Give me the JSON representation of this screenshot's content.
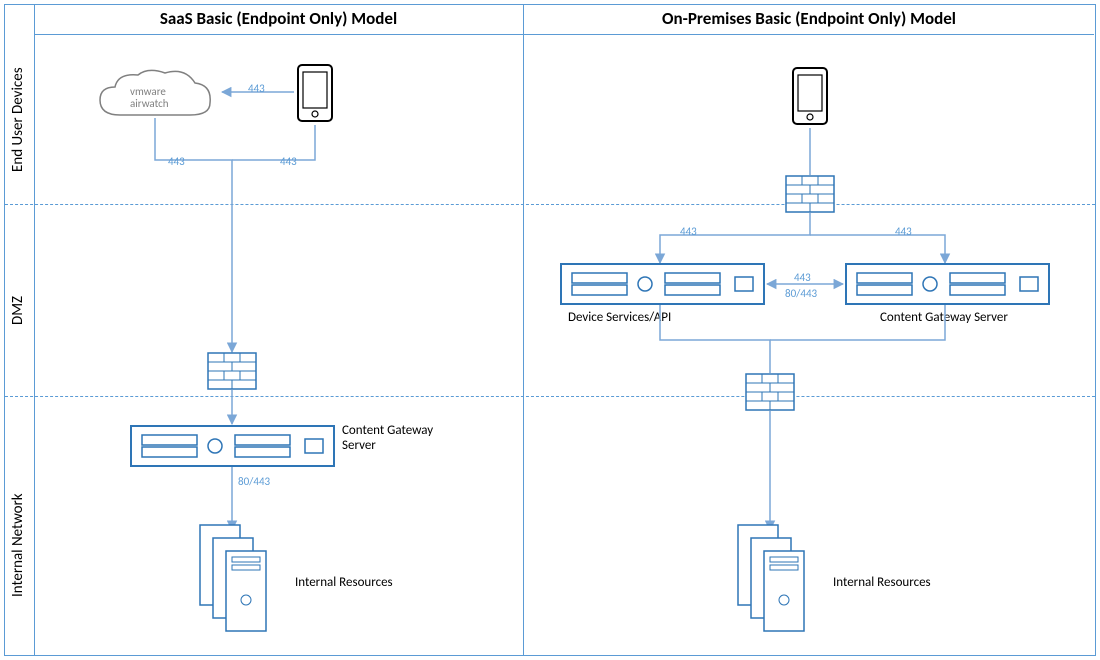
{
  "titles": {
    "saas": "SaaS Basic (Endpoint Only) Model",
    "onprem": "On-Premises Basic (Endpoint Only) Model"
  },
  "rows": {
    "r1": "End User Devices",
    "r2": "DMZ",
    "r3": "Internal Network"
  },
  "cloud": {
    "l1": "vmware",
    "l2": "airwatch"
  },
  "ports": {
    "p443": "443",
    "p80443": "80/443"
  },
  "labels": {
    "cgs": "Content Gateway Server",
    "ir": "Internal Resources",
    "dsapi": "Device Services/API"
  }
}
